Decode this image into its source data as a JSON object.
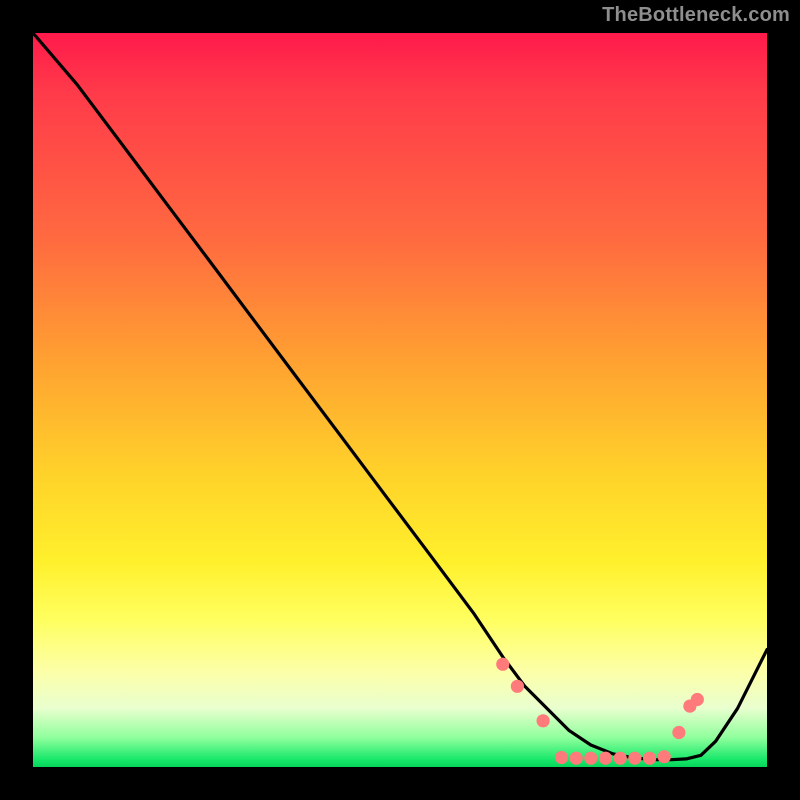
{
  "watermark": "TheBottleneck.com",
  "chart_data": {
    "type": "line",
    "title": "",
    "xlabel": "",
    "ylabel": "",
    "xlim": [
      0,
      100
    ],
    "ylim": [
      0,
      100
    ],
    "grid": false,
    "series": [
      {
        "name": "curve",
        "color": "#000000",
        "x": [
          0,
          6,
          12,
          18,
          24,
          30,
          36,
          42,
          48,
          54,
          60,
          64,
          67,
          70,
          73,
          76,
          79,
          82,
          85,
          87,
          89,
          91,
          93,
          96,
          100
        ],
        "y": [
          100,
          93,
          85,
          77,
          69,
          61,
          53,
          45,
          37,
          29,
          21,
          15,
          11,
          8,
          5,
          3,
          1.8,
          1.2,
          1.0,
          1.0,
          1.1,
          1.6,
          3.5,
          8,
          16
        ]
      }
    ],
    "markers": {
      "name": "dots",
      "color": "#ff7a7a",
      "radius_pct": 0.9,
      "x": [
        64,
        66,
        69.5,
        72,
        74,
        76,
        78,
        80,
        82,
        84,
        86,
        88,
        89.5,
        90.5
      ],
      "y": [
        14,
        11,
        6.3,
        1.3,
        1.2,
        1.2,
        1.2,
        1.2,
        1.2,
        1.2,
        1.4,
        4.7,
        8.3,
        9.2
      ]
    }
  }
}
